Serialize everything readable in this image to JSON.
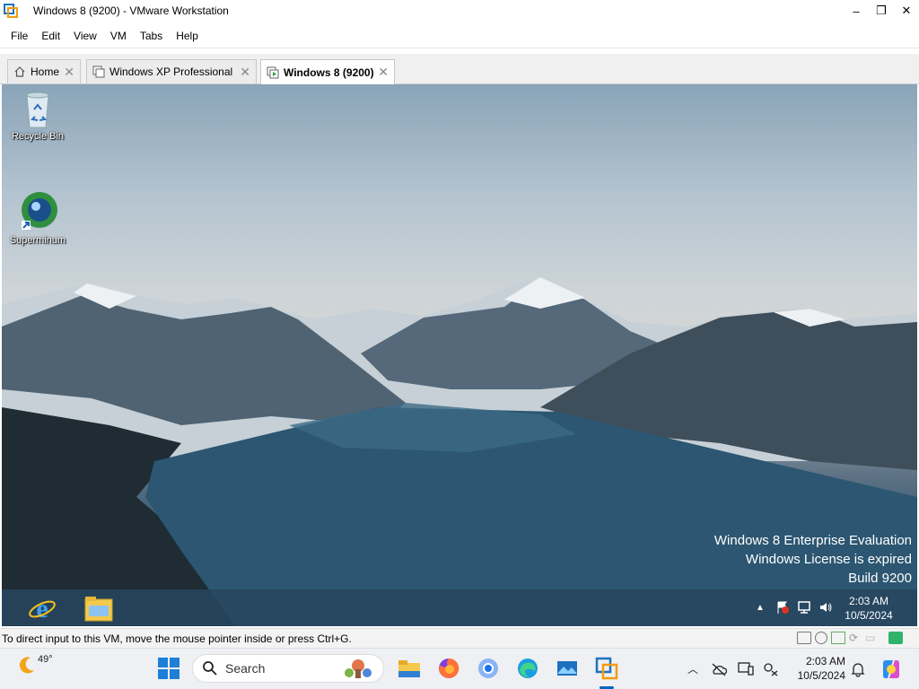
{
  "window": {
    "title": "Windows 8 (9200) - VMware Workstation",
    "controls": {
      "minimize": "–",
      "maximize": "❐",
      "close": "✕"
    }
  },
  "menu": [
    "File",
    "Edit",
    "View",
    "VM",
    "Tabs",
    "Help"
  ],
  "tabs": [
    {
      "label": "Home",
      "icon": "home-icon",
      "active": false
    },
    {
      "label": "Windows XP Professional",
      "icon": "vm-icon",
      "active": false
    },
    {
      "label": "Windows 8 (9200)",
      "icon": "vm-running-icon",
      "active": true
    }
  ],
  "guest": {
    "desktop_icons": [
      {
        "label": "Recycle Bin",
        "icon": "recycle-bin-icon"
      },
      {
        "label": "Superminum",
        "icon": "superminum-icon"
      }
    ],
    "watermark": {
      "line1": "Windows 8 Enterprise Evaluation",
      "line2": "Windows License is expired",
      "line3": "Build 9200"
    },
    "taskbar": {
      "apps": [
        "internet-explorer-icon",
        "file-explorer-icon"
      ],
      "time": "2:03 AM",
      "date": "10/5/2024"
    }
  },
  "status": {
    "message": "To direct input to this VM, move the mouse pointer inside or press Ctrl+G."
  },
  "host_taskbar": {
    "weather_temp": "49°",
    "search_placeholder": "Search",
    "apps": [
      "start-icon",
      "file-explorer-icon",
      "firefox-icon",
      "chrome-icon",
      "edge-icon",
      "photos-icon",
      "vmware-icon"
    ],
    "time": "2:03 AM",
    "date": "10/5/2024"
  },
  "colors": {
    "accent": "#0067c0",
    "vm_taskbar": "#28465f"
  }
}
